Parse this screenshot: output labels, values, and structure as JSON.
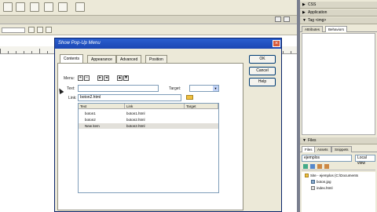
{
  "right_panel": {
    "css_label": "CSS",
    "application_label": "Application",
    "tag_label": "Tag <img>",
    "tabs": [
      "Attributes",
      "Behaviors"
    ],
    "files": {
      "header": "Files",
      "tabs": [
        "Files",
        "Assets",
        "Snippets"
      ],
      "site_select": "ejemplos",
      "view_select": "Local view",
      "tree": [
        {
          "label": "Site - ejemplos (C:\\Documents"
        },
        {
          "label": "boton.jpg"
        },
        {
          "label": "index.html"
        }
      ]
    }
  },
  "dialog": {
    "title": "Show Pop-Up Menu",
    "tabs": [
      "Contents",
      "Appearance",
      "Advanced",
      "Position"
    ],
    "buttons": {
      "ok": "OK",
      "cancel": "Cancel",
      "help": "Help"
    },
    "menu_label": "Menu:",
    "text_label": "Text:",
    "link_label": "Link:",
    "target_label": "Target:",
    "link_value": "boton2.html",
    "text_value": "",
    "table": {
      "columns": [
        "Text",
        "Link",
        "Target"
      ],
      "rows": [
        {
          "text": "boton1",
          "link": "boton1.html",
          "target": ""
        },
        {
          "text": "boton2",
          "link": "boton2.html",
          "target": ""
        },
        {
          "text": "New item",
          "link": "boton2.html",
          "target": ""
        }
      ]
    }
  },
  "colors": {
    "title_bar": "#1b46b3",
    "chrome": "#ece9d8"
  }
}
